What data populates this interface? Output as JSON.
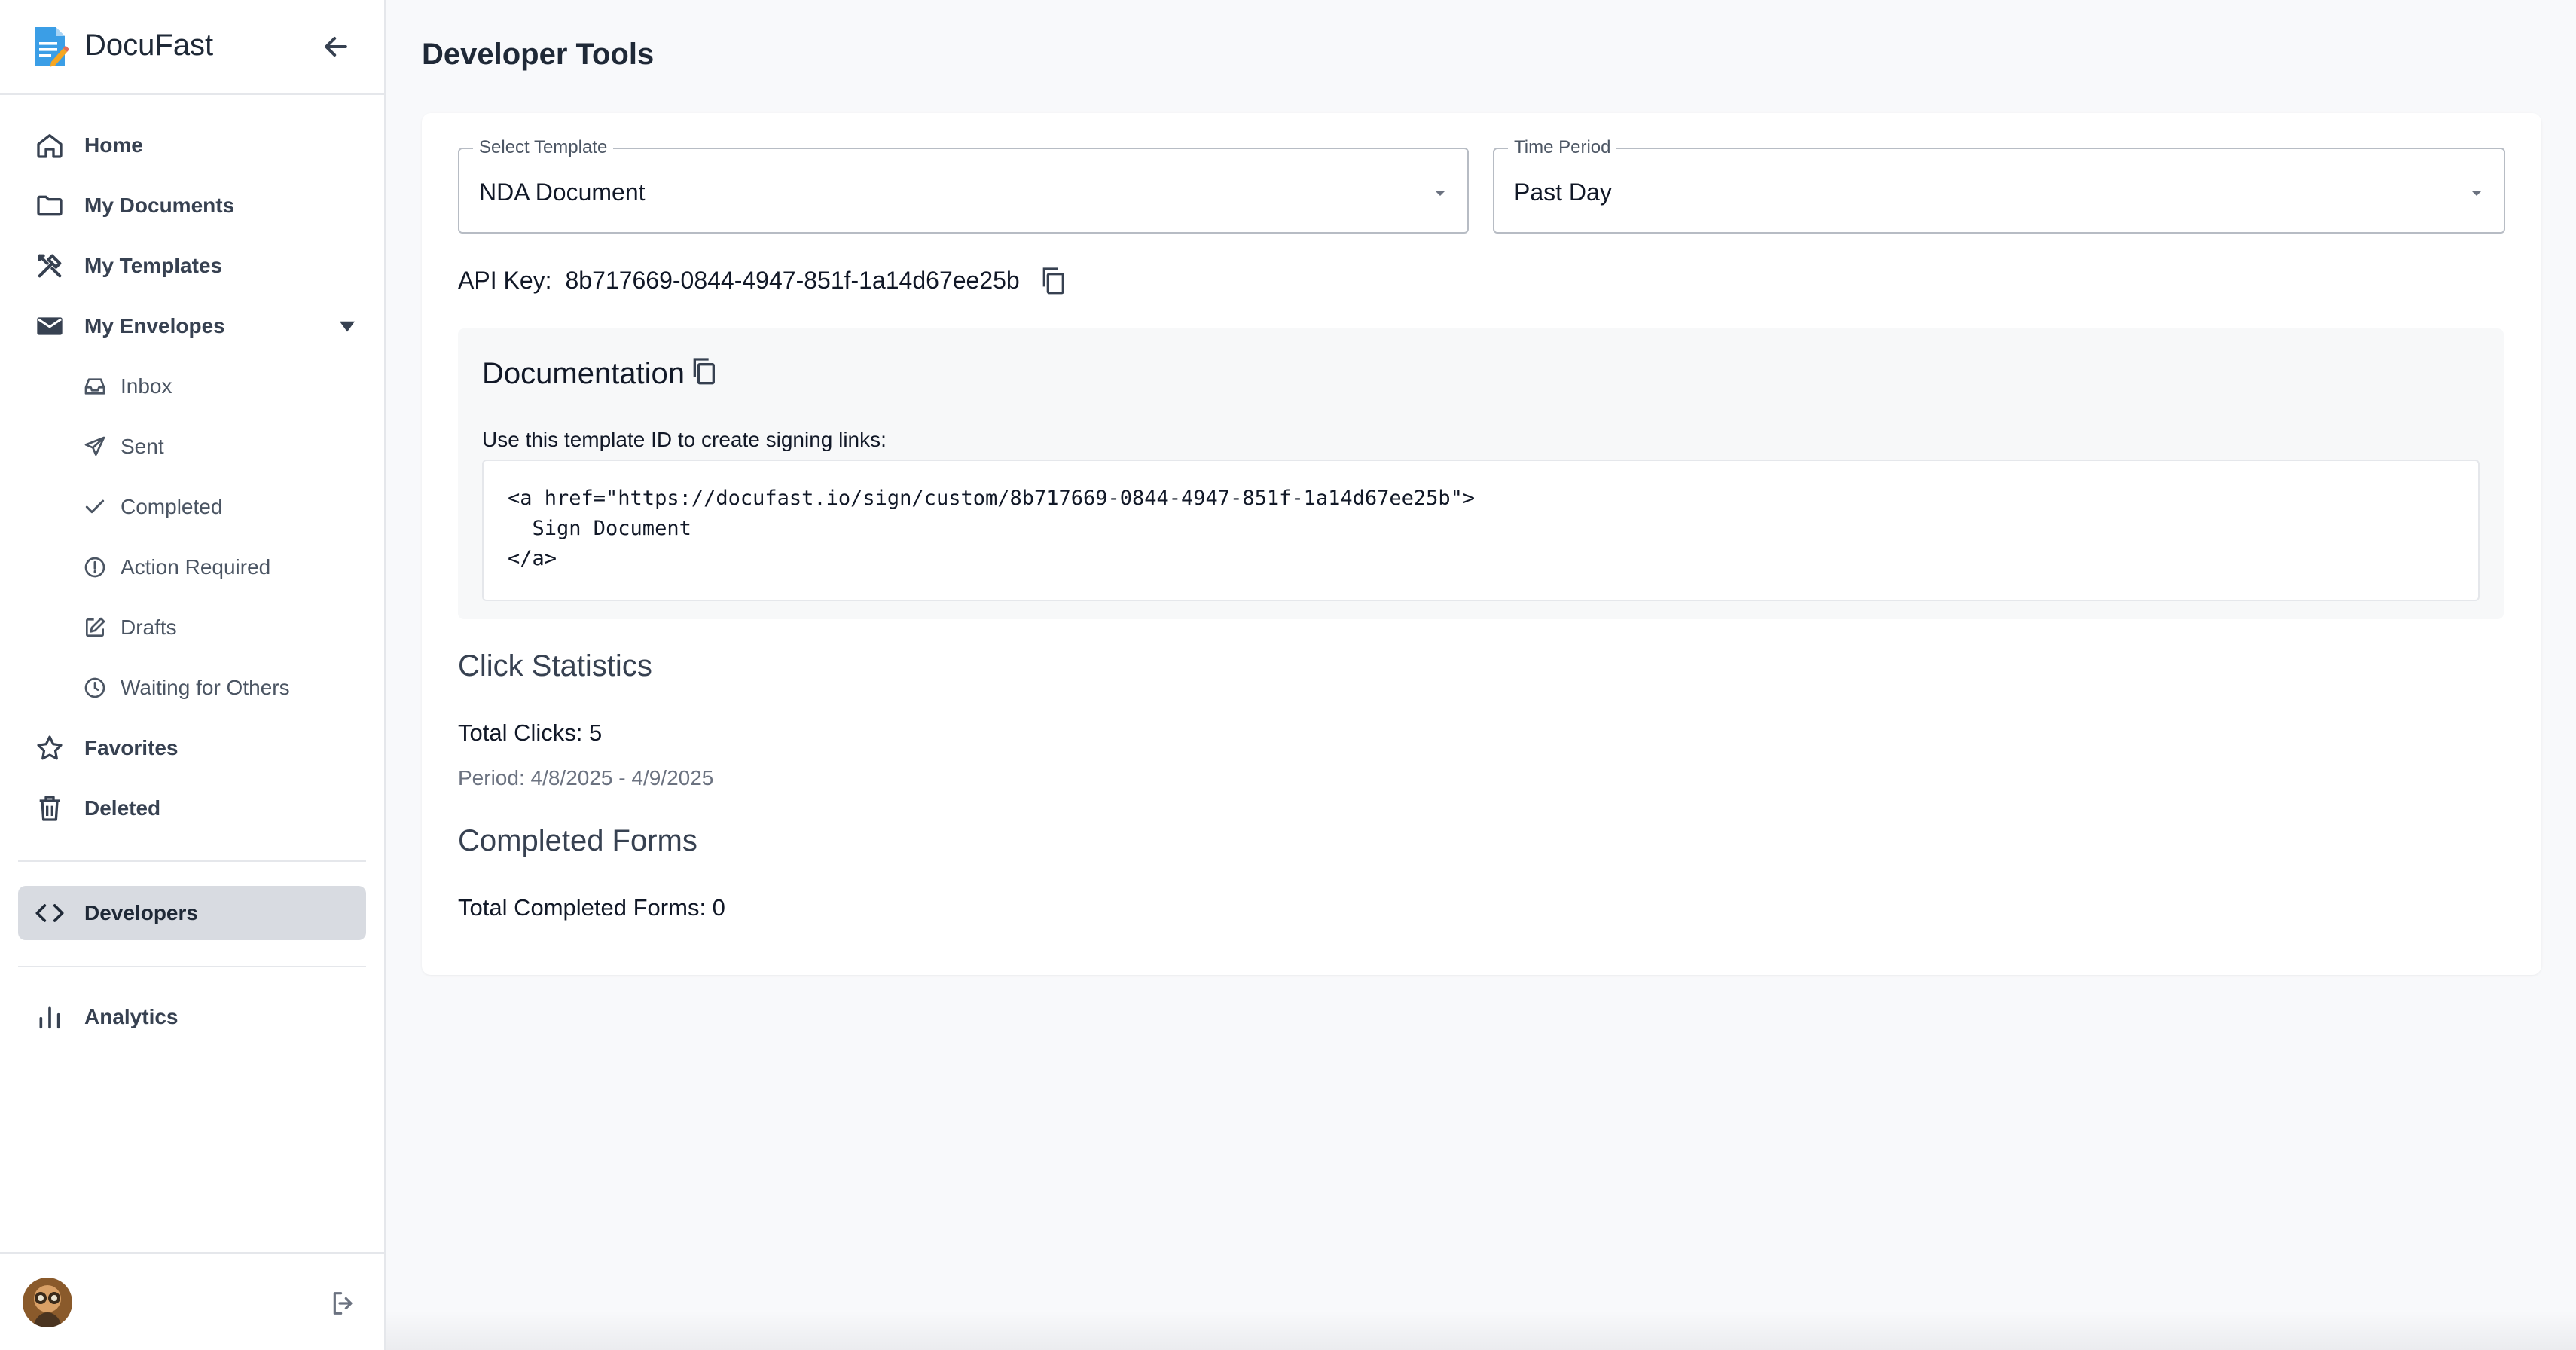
{
  "app": {
    "name": "DocuFast"
  },
  "sidebar": {
    "items": [
      {
        "label": "Home"
      },
      {
        "label": "My Documents"
      },
      {
        "label": "My Templates"
      },
      {
        "label": "My Envelopes"
      }
    ],
    "envelopes": [
      {
        "label": "Inbox"
      },
      {
        "label": "Sent"
      },
      {
        "label": "Completed"
      },
      {
        "label": "Action Required"
      },
      {
        "label": "Drafts"
      },
      {
        "label": "Waiting for Others"
      }
    ],
    "bottom_items": [
      {
        "label": "Favorites"
      },
      {
        "label": "Deleted"
      }
    ],
    "developers": {
      "label": "Developers"
    },
    "analytics": {
      "label": "Analytics"
    }
  },
  "main": {
    "title": "Developer Tools",
    "template_select": {
      "legend": "Select Template",
      "value": "NDA Document"
    },
    "period_select": {
      "legend": "Time Period",
      "value": "Past Day"
    },
    "api_key": {
      "label": "API Key:",
      "value": "8b717669-0844-4947-851f-1a14d67ee25b"
    },
    "documentation": {
      "title": "Documentation",
      "hint": "Use this template ID to create signing links:",
      "code": "<a href=\"https://docufast.io/sign/custom/8b717669-0844-4947-851f-1a14d67ee25b\">\n  Sign Document\n</a>"
    },
    "click_stats": {
      "title": "Click Statistics",
      "total": "Total Clicks: 5",
      "period": "Period: 4/8/2025 - 4/9/2025"
    },
    "completed_forms": {
      "title": "Completed Forms",
      "total": "Total Completed Forms: 0"
    }
  },
  "colors": {
    "accent": "#3b9ee6",
    "active_bg": "#d8dbe1",
    "text": "#1f2937"
  }
}
